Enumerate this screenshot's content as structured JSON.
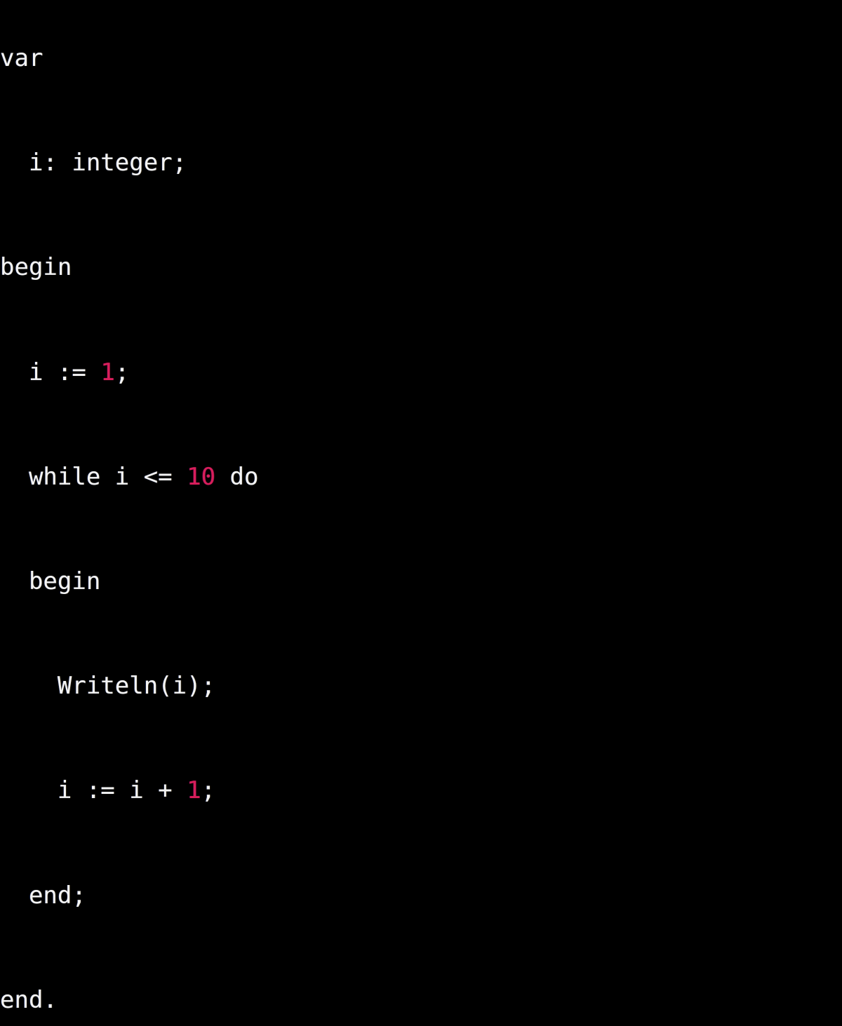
{
  "window": {
    "background_color": "#000000",
    "foreground_color": "#f4f4f4",
    "number_color": "#d81e5b",
    "language": "pascal"
  },
  "code": {
    "lines": [
      {
        "indent": "",
        "tokens": [
          {
            "type": "plain",
            "text": "var"
          }
        ]
      },
      {
        "indent": "  ",
        "tokens": [
          {
            "type": "plain",
            "text": "i: integer;"
          }
        ]
      },
      {
        "indent": "",
        "tokens": [
          {
            "type": "plain",
            "text": "begin"
          }
        ]
      },
      {
        "indent": "  ",
        "tokens": [
          {
            "type": "plain",
            "text": "i := "
          },
          {
            "type": "number",
            "text": "1"
          },
          {
            "type": "plain",
            "text": ";"
          }
        ]
      },
      {
        "indent": "  ",
        "tokens": [
          {
            "type": "plain",
            "text": "while i <= "
          },
          {
            "type": "number",
            "text": "10"
          },
          {
            "type": "plain",
            "text": " do"
          }
        ]
      },
      {
        "indent": "  ",
        "tokens": [
          {
            "type": "plain",
            "text": "begin"
          }
        ]
      },
      {
        "indent": "    ",
        "tokens": [
          {
            "type": "plain",
            "text": "Writeln(i);"
          }
        ]
      },
      {
        "indent": "    ",
        "tokens": [
          {
            "type": "plain",
            "text": "i := i + "
          },
          {
            "type": "number",
            "text": "1"
          },
          {
            "type": "plain",
            "text": ";"
          }
        ]
      },
      {
        "indent": "  ",
        "tokens": [
          {
            "type": "plain",
            "text": "end;"
          }
        ]
      },
      {
        "indent": "",
        "tokens": [
          {
            "type": "plain",
            "text": "end."
          }
        ]
      }
    ]
  }
}
